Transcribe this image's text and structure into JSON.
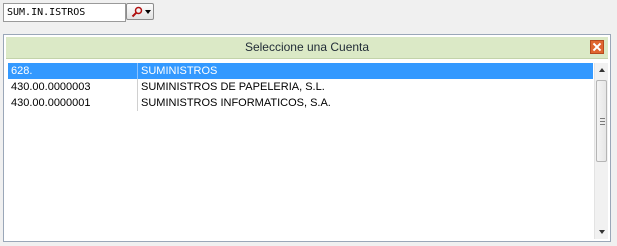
{
  "search": {
    "value": "SUM.IN.ISTROS"
  },
  "dialog": {
    "title": "Seleccione una Cuenta",
    "rows": [
      {
        "code": "628.",
        "name": "SUMINISTROS",
        "selected": true
      },
      {
        "code": "430.00.0000003",
        "name": "SUMINISTROS DE PAPELERIA, S.L.",
        "selected": false
      },
      {
        "code": "430.00.0000001",
        "name": "SUMINISTROS INFORMATICOS, S.A.",
        "selected": false
      }
    ]
  },
  "colors": {
    "header_bg": "#dbe9c6",
    "selection": "#3399ff",
    "close_button": "#e0662f"
  },
  "icons": {
    "search_button": "magnifier-icon",
    "dropdown": "caret-down-icon",
    "close": "close-x-icon"
  }
}
